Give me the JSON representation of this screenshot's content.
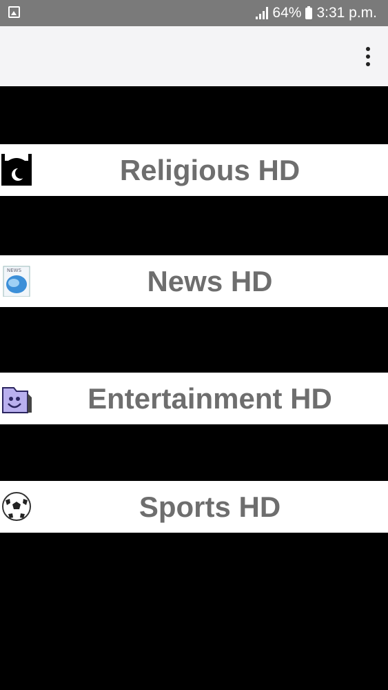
{
  "status_bar": {
    "battery_percent": "64%",
    "time": "3:31 p.m.",
    "icons": [
      "gallery-icon",
      "signal-icon",
      "battery-charging-icon"
    ]
  },
  "app_bar": {
    "menu_icon": "more-vert-icon"
  },
  "categories": [
    {
      "label": "Religious HD",
      "icon": "mosque-icon"
    },
    {
      "label": "News HD",
      "icon": "news-icon"
    },
    {
      "label": "Entertainment HD",
      "icon": "smiley-folder-icon"
    },
    {
      "label": "Sports HD",
      "icon": "soccer-ball-icon"
    }
  ]
}
